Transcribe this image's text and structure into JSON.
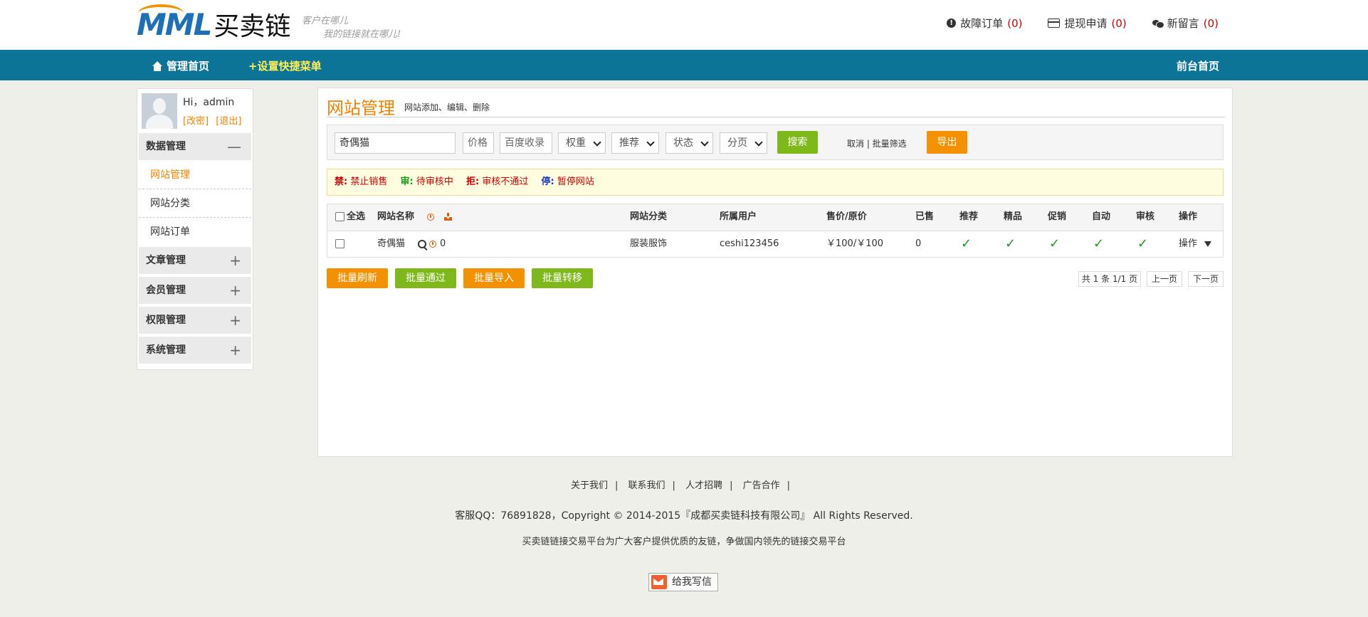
{
  "header": {
    "logo_mark": "MML",
    "logo_text": "买卖链",
    "slogan_line1": "客户在哪儿",
    "slogan_line2": "我的链接就在哪儿!",
    "links": [
      {
        "label": "故障订单",
        "count": "(0)",
        "icon": "warning-icon"
      },
      {
        "label": "提现申请",
        "count": "(0)",
        "icon": "card-icon"
      },
      {
        "label": "新留言",
        "count": "(0)",
        "icon": "chat-icon"
      }
    ]
  },
  "navbar": {
    "home": "管理首页",
    "quick_menu": "+设置快捷菜单",
    "front_home": "前台首页"
  },
  "sidebar": {
    "greeting": "Hi，admin",
    "change_pwd": "[改密]",
    "logout": "[退出]",
    "groups": [
      {
        "label": "数据管理",
        "toggle": "—"
      },
      {
        "label": "文章管理",
        "toggle": "+"
      },
      {
        "label": "会员管理",
        "toggle": "+"
      },
      {
        "label": "权限管理",
        "toggle": "+"
      },
      {
        "label": "系统管理",
        "toggle": "+"
      }
    ],
    "items": [
      "网站管理",
      "网站分类",
      "网站订单"
    ]
  },
  "main": {
    "title": "网站管理",
    "subtitle": "网站添加、编辑、删除",
    "filter": {
      "keyword": "奇偶猫",
      "price_placeholder": "价格",
      "baidu_placeholder": "百度收录",
      "weight": "权重",
      "recommend": "推荐",
      "status": "状态",
      "paging": "分页",
      "search": "搜索",
      "cancel_link": "取消 | 批量筛选",
      "export": "导出"
    },
    "legend": [
      {
        "key": "禁:",
        "text": "禁止销售",
        "color": "#cc0000"
      },
      {
        "key": "审:",
        "text": "待审核中",
        "color": "#cc0000",
        "key_color": "#1a9a1a"
      },
      {
        "key": "拒:",
        "text": "审核不通过",
        "color": "#cc0000"
      },
      {
        "key": "停:",
        "text": "暂停网站",
        "color": "#cc0000",
        "key_color": "#1a3acc"
      }
    ],
    "table": {
      "headers": [
        "全选",
        "网站名称",
        "网站分类",
        "所属用户",
        "售价/原价",
        "已售",
        "推荐",
        "精品",
        "促销",
        "自动",
        "审核",
        "操作"
      ],
      "rows": [
        {
          "name": "奇偶猫",
          "stat": "0",
          "category": "服装服饰",
          "user": "ceshi123456",
          "price": "￥100/￥100",
          "sold": "0",
          "recommend": "✓",
          "fine": "✓",
          "promo": "✓",
          "auto": "✓",
          "audit": "✓",
          "action": "操作"
        }
      ]
    },
    "batch_buttons": [
      "批量刷新",
      "批量通过",
      "批量导入",
      "批量转移"
    ],
    "pager": {
      "info": "共 1 条 1/1 页",
      "prev": "上一页",
      "next": "下一页"
    }
  },
  "footer": {
    "links": [
      "关于我们",
      "联系我们",
      "人才招聘",
      "广告合作"
    ],
    "separator": "|",
    "copyright": "客服QQ：76891828，Copyright © 2014-2015『成都买卖链科技有限公司』 All Rights Reserved.",
    "slogan": "买卖链链接交易平台为广大客户提供优质的友链，争做国内领先的链接交易平台",
    "mail_button": "给我写信"
  }
}
